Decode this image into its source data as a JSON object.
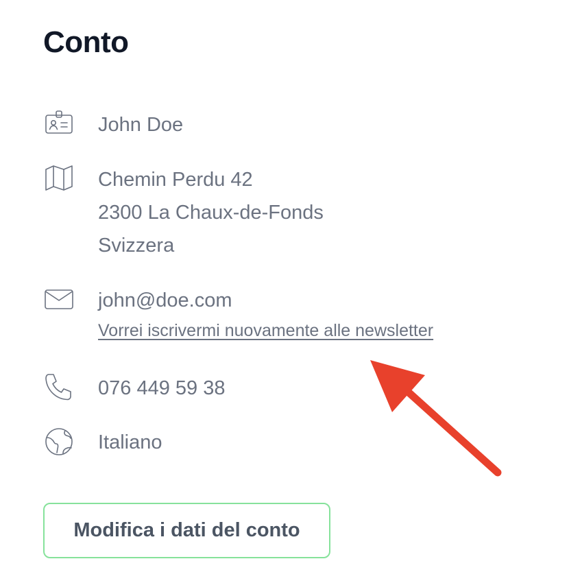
{
  "account": {
    "title": "Conto",
    "name": "John Doe",
    "address": {
      "street": "Chemin Perdu 42",
      "city": "2300 La Chaux-de-Fonds",
      "country": "Svizzera"
    },
    "email": "john@doe.com",
    "newsletter_link": "Vorrei iscrivermi nuovamente alle newsletter",
    "phone": "076 449 59 38",
    "language": "Italiano",
    "edit_button": "Modifica i dati del conto"
  },
  "icons": {
    "name": "id-card-icon",
    "address": "map-icon",
    "email": "envelope-icon",
    "phone": "phone-icon",
    "language": "globe-icon"
  },
  "colors": {
    "text": "#6b7280",
    "title": "#111827",
    "button_border": "#86e29b",
    "annotation_arrow": "#e8412c"
  }
}
